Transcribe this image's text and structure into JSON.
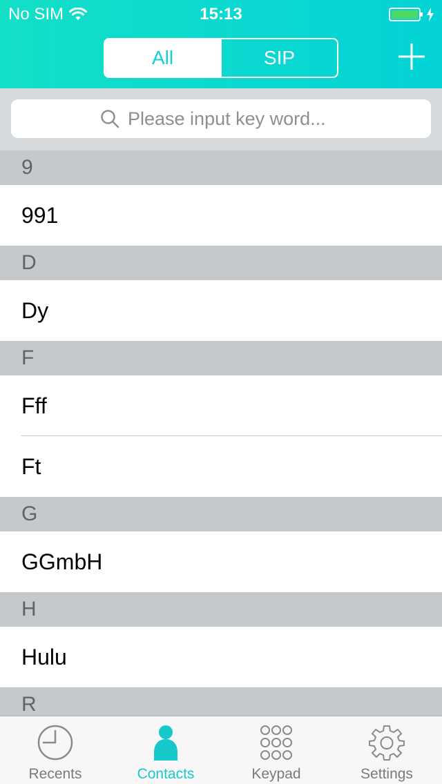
{
  "status_bar": {
    "carrier": "No SIM",
    "time": "15:13"
  },
  "header": {
    "segments": [
      {
        "label": "All",
        "active": true
      },
      {
        "label": "SIP",
        "active": false
      }
    ],
    "add_icon": "plus-icon"
  },
  "search": {
    "placeholder": "Please input key word...",
    "value": "",
    "icon": "search-icon"
  },
  "contacts": {
    "sections": [
      {
        "letter": "9",
        "names": [
          "991"
        ]
      },
      {
        "letter": "D",
        "names": [
          "Dy"
        ]
      },
      {
        "letter": "F",
        "names": [
          "Fff",
          "Ft"
        ]
      },
      {
        "letter": "G",
        "names": [
          "GGmbH"
        ]
      },
      {
        "letter": "H",
        "names": [
          "Hulu"
        ]
      },
      {
        "letter": "R",
        "names": []
      }
    ]
  },
  "tabbar": {
    "tabs": [
      {
        "label": "Recents",
        "icon": "clock-icon",
        "active": false
      },
      {
        "label": "Contacts",
        "icon": "person-icon",
        "active": true
      },
      {
        "label": "Keypad",
        "icon": "keypad-icon",
        "active": false
      },
      {
        "label": "Settings",
        "icon": "gear-icon",
        "active": false
      }
    ]
  },
  "colors": {
    "accent": "#14cfcf",
    "section_bg": "#c5c9cc",
    "search_bg": "#d6dadc"
  }
}
